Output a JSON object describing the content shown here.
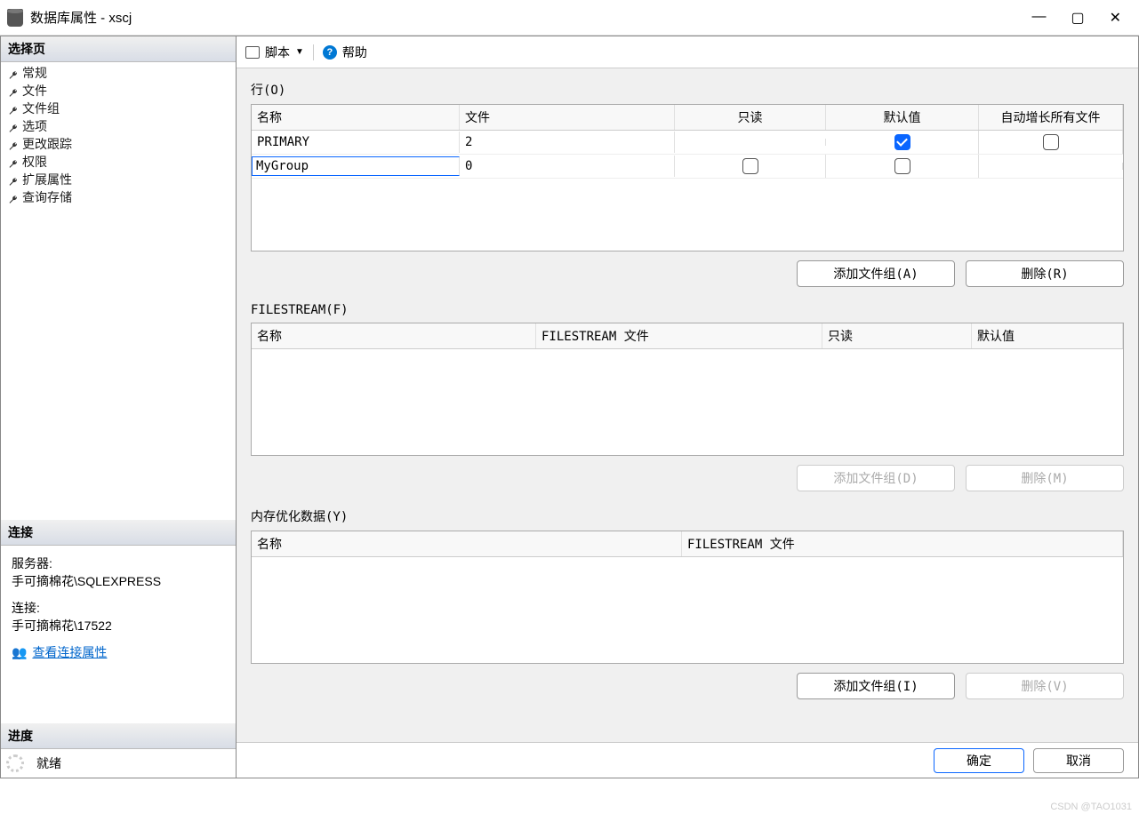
{
  "window": {
    "title": "数据库属性 - xscj"
  },
  "sidebar": {
    "select_page": "选择页",
    "items": [
      {
        "label": "常规"
      },
      {
        "label": "文件"
      },
      {
        "label": "文件组"
      },
      {
        "label": "选项"
      },
      {
        "label": "更改跟踪"
      },
      {
        "label": "权限"
      },
      {
        "label": "扩展属性"
      },
      {
        "label": "查询存储"
      }
    ],
    "connection_header": "连接",
    "server_label": "服务器:",
    "server_value": "手可摘棉花\\SQLEXPRESS",
    "conn_label": "连接:",
    "conn_value": "手可摘棉花\\17522",
    "view_conn_props": "查看连接属性",
    "progress_header": "进度",
    "ready": "就绪"
  },
  "toolbar": {
    "script": "脚本",
    "help": "帮助"
  },
  "rows_section": {
    "label": "行(O)",
    "cols": {
      "name": "名称",
      "file": "文件",
      "readonly": "只读",
      "default": "默认值",
      "autogrow": "自动增长所有文件"
    },
    "rows": [
      {
        "name": "PRIMARY",
        "file": "2",
        "readonly": null,
        "default": true,
        "autogrow": false
      },
      {
        "name": "MyGroup",
        "file": "0",
        "readonly": false,
        "default": false,
        "autogrow": null
      }
    ],
    "add_btn": "添加文件组(A)",
    "del_btn": "删除(R)"
  },
  "filestream_section": {
    "label": "FILESTREAM(F)",
    "cols": {
      "name": "名称",
      "fsfile": "FILESTREAM 文件",
      "readonly": "只读",
      "default": "默认值"
    },
    "add_btn": "添加文件组(D)",
    "del_btn": "删除(M)"
  },
  "memopt_section": {
    "label": "内存优化数据(Y)",
    "cols": {
      "name": "名称",
      "fsfile": "FILESTREAM 文件"
    },
    "add_btn": "添加文件组(I)",
    "del_btn": "删除(V)"
  },
  "footer": {
    "ok": "确定",
    "cancel": "取消"
  },
  "watermark": "CSDN @TAO1031"
}
